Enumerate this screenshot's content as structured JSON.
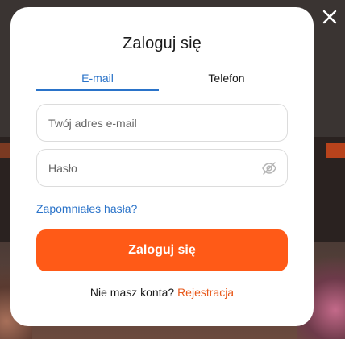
{
  "modal": {
    "title": "Zaloguj się",
    "tabs": [
      {
        "label": "E-mail",
        "active": true
      },
      {
        "label": "Telefon",
        "active": false
      }
    ],
    "email_placeholder": "Twój adres e-mail",
    "password_placeholder": "Hasło",
    "forgot_link": "Zapomniałeś hasła?",
    "submit_label": "Zaloguj się",
    "register_prompt": "Nie masz konta?",
    "register_link": "Rejestracja"
  },
  "icons": {
    "close": "close-icon",
    "password_toggle": "eye-off-icon"
  },
  "colors": {
    "accent_blue": "#2a73c9",
    "primary_orange": "#ff5a17",
    "register_link": "#e85a1c"
  }
}
